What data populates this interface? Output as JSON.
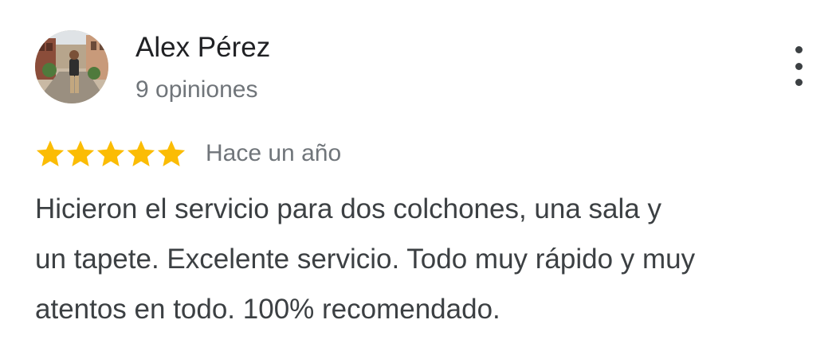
{
  "author": {
    "name": "Alex Pérez",
    "meta": "9 opiniones",
    "avatar_icon": "user-photo-avatar"
  },
  "rating": {
    "stars": 5,
    "max_stars": 5,
    "star_color": "#fbbc04",
    "date": "Hace un año"
  },
  "review": {
    "lines": [
      "Hicieron el servicio para dos colchones, una sala y",
      "un tapete. Excelente servicio. Todo muy rápido y muy",
      "atentos en todo. 100% recomendado."
    ]
  },
  "menu": {
    "icon": "more-vert-icon"
  },
  "colors": {
    "name": "#202124",
    "meta": "#70757a",
    "body": "#3c4043"
  }
}
